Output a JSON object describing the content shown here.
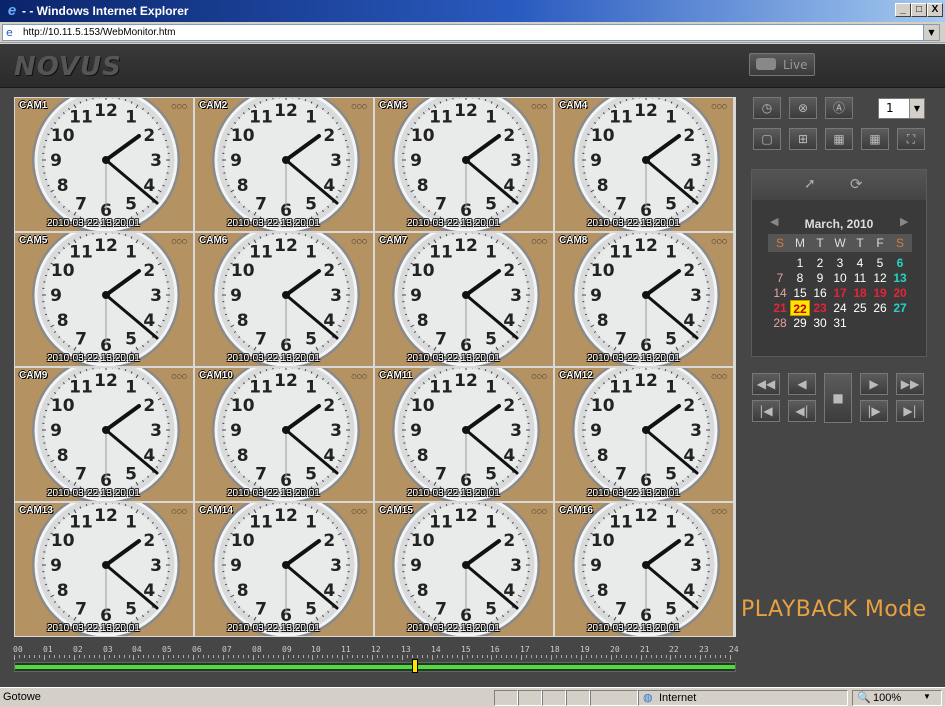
{
  "window": {
    "title": "- - Windows Internet Explorer",
    "min": "_",
    "max": "□",
    "close": "X"
  },
  "address": {
    "url": "http://10.11.5.153/WebMonitor.htm"
  },
  "header": {
    "logo": "NOVUS",
    "live_label": "Live"
  },
  "cameras": [
    {
      "label": "CAM1",
      "timestamp": "2010-03-22 13:20:01",
      "selected": true
    },
    {
      "label": "CAM2",
      "timestamp": "2010-03-22 13:20:01"
    },
    {
      "label": "CAM3",
      "timestamp": "2010-03-22 13:20:01"
    },
    {
      "label": "CAM4",
      "timestamp": "2010-03-22 13:20:01"
    },
    {
      "label": "CAM5",
      "timestamp": "2010-03-22 13:20:01"
    },
    {
      "label": "CAM6",
      "timestamp": "2010-03-22 13:20:01"
    },
    {
      "label": "CAM7",
      "timestamp": "2010-03-22 13:20:01"
    },
    {
      "label": "CAM8",
      "timestamp": "2010-03-22 13:20:01"
    },
    {
      "label": "CAM9",
      "timestamp": "2010-03-22 13:20:01"
    },
    {
      "label": "CAM10",
      "timestamp": "2010-03-22 13:20:01"
    },
    {
      "label": "CAM11",
      "timestamp": "2010-03-22 13:20:01"
    },
    {
      "label": "CAM12",
      "timestamp": "2010-03-22 13:20:01"
    },
    {
      "label": "CAM13",
      "timestamp": "2010-03-22 13:20:01"
    },
    {
      "label": "CAM14",
      "timestamp": "2010-03-22 13:20:01"
    },
    {
      "label": "CAM15",
      "timestamp": "2010-03-22 13:20:01"
    },
    {
      "label": "CAM16",
      "timestamp": "2010-03-22 13:20:01"
    }
  ],
  "camera_indicator": "○○○",
  "timeline": {
    "hours": [
      "00",
      "01",
      "02",
      "03",
      "04",
      "05",
      "06",
      "07",
      "08",
      "09",
      "10",
      "11",
      "12",
      "13",
      "14",
      "15",
      "16",
      "17",
      "18",
      "19",
      "20",
      "21",
      "22",
      "23",
      "24"
    ],
    "recorded_fraction": 1.0,
    "cursor_hour": 13.33
  },
  "layout_select": {
    "value": "1"
  },
  "calendar": {
    "title": "March, 2010",
    "prev": "◀",
    "next": "▶",
    "weekdays": [
      "S",
      "M",
      "T",
      "W",
      "T",
      "F",
      "S"
    ],
    "days": [
      {
        "d": "1",
        "style": ""
      },
      {
        "d": "2",
        "style": ""
      },
      {
        "d": "3",
        "style": ""
      },
      {
        "d": "4",
        "style": ""
      },
      {
        "d": "5",
        "style": ""
      },
      {
        "d": "6",
        "style": "cyan"
      },
      {
        "d": "7",
        "style": "pink"
      },
      {
        "d": "8",
        "style": ""
      },
      {
        "d": "9",
        "style": ""
      },
      {
        "d": "10",
        "style": ""
      },
      {
        "d": "11",
        "style": ""
      },
      {
        "d": "12",
        "style": ""
      },
      {
        "d": "13",
        "style": "cyan"
      },
      {
        "d": "14",
        "style": "pink"
      },
      {
        "d": "15",
        "style": ""
      },
      {
        "d": "16",
        "style": ""
      },
      {
        "d": "17",
        "style": "red"
      },
      {
        "d": "18",
        "style": "red"
      },
      {
        "d": "19",
        "style": "red"
      },
      {
        "d": "20",
        "style": "red"
      },
      {
        "d": "21",
        "style": "red"
      },
      {
        "d": "22",
        "style": "today"
      },
      {
        "d": "23",
        "style": "red"
      },
      {
        "d": "24",
        "style": ""
      },
      {
        "d": "25",
        "style": ""
      },
      {
        "d": "26",
        "style": ""
      },
      {
        "d": "27",
        "style": "cyan"
      },
      {
        "d": "28",
        "style": "pink"
      },
      {
        "d": "29",
        "style": ""
      },
      {
        "d": "30",
        "style": ""
      },
      {
        "d": "31",
        "style": ""
      }
    ],
    "first_weekday": 1
  },
  "mode_text": "PLAYBACK Mode",
  "status": {
    "text": "Gotowe",
    "zone": "Internet",
    "zoom": "100%"
  }
}
